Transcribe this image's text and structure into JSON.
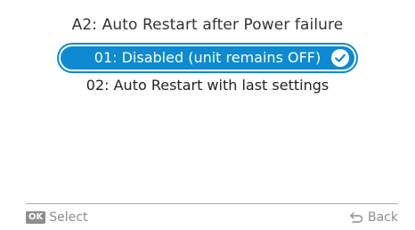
{
  "header": {
    "title": "A2: Auto Restart after Power failure"
  },
  "options": [
    {
      "label": "01: Disabled (unit remains OFF)",
      "selected": true
    },
    {
      "label": "02: Auto Restart with last settings",
      "selected": false
    }
  ],
  "footer": {
    "ok_badge": "OK",
    "select_label": "Select",
    "back_label": "Back"
  },
  "icons": {
    "selected_check": "check-circle-icon",
    "back": "back-arrow-icon"
  },
  "colors": {
    "accent": "#0d8ad1",
    "footer_text": "#8e8e8e"
  }
}
